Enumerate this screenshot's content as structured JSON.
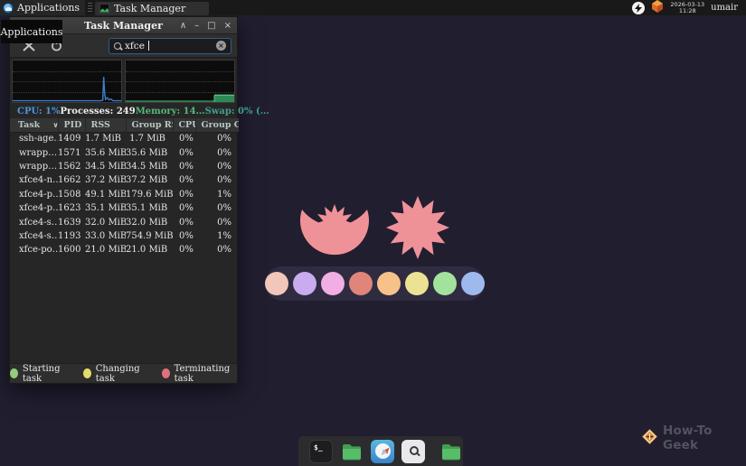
{
  "top_bar": {
    "applications_label": "Applications",
    "task_button_label": "Task Manager",
    "clock_date": "2026-03-13",
    "clock_time": "11:28",
    "username": "umair"
  },
  "tooltip": {
    "label": "Applications"
  },
  "icons": {
    "shade": "∧",
    "minimize": "–",
    "maximize": "□",
    "close": "×",
    "sort_caret": "∨",
    "clear": "×"
  },
  "window": {
    "title": "Task Manager",
    "search": {
      "value": "xfce",
      "placeholder": ""
    },
    "stats": [
      {
        "label": "CPU: 1%",
        "color": "#4f96d8"
      },
      {
        "label": "Processes: 249",
        "color": "#ededed"
      },
      {
        "label": "Memory: 14…",
        "color": "#55b877"
      },
      {
        "label": "Swap: 0% (…",
        "color": "#3fa08e"
      }
    ],
    "graphs": {
      "cpu_current_percent": 1,
      "memory_bar_fraction": 0.16,
      "memory_bar_start_fraction": 0.82,
      "cpu_color": "#3f7ec9",
      "memory_color": "#2e8a55"
    },
    "table": {
      "columns": [
        "Task",
        "PID",
        "RSS",
        "Group RSS",
        "CPU",
        "Group CPU"
      ],
      "rows": [
        [
          "ssh-age…",
          "1409",
          "1.7 MiB",
          "1.7 MiB",
          "0%",
          "0%"
        ],
        [
          "wrapp…",
          "1571",
          "35.6 MiB",
          "35.6 MiB",
          "0%",
          "0%"
        ],
        [
          "wrapp…",
          "1562",
          "34.5 MiB",
          "34.5 MiB",
          "0%",
          "0%"
        ],
        [
          "xfce4-n…",
          "1662",
          "37.2 MiB",
          "37.2 MiB",
          "0%",
          "0%"
        ],
        [
          "xfce4-p…",
          "1508",
          "49.1 MiB",
          "179.6 MiB",
          "0%",
          "1%"
        ],
        [
          "xfce4-p…",
          "1623",
          "35.1 MiB",
          "35.1 MiB",
          "0%",
          "0%"
        ],
        [
          "xfce4-s…",
          "1639",
          "32.0 MiB",
          "32.0 MiB",
          "0%",
          "0%"
        ],
        [
          "xfce4-s…",
          "1193",
          "33.0 MiB",
          "754.9 MiB",
          "0%",
          "1%"
        ],
        [
          "xfce-po…",
          "1600",
          "21.0 MiB",
          "21.0 MiB",
          "0%",
          "0%"
        ]
      ]
    },
    "legend": [
      {
        "label": "Starting task",
        "color": "#94ca7e"
      },
      {
        "label": "Changing task",
        "color": "#e7da6b"
      },
      {
        "label": "Terminating task",
        "color": "#e0707c"
      }
    ]
  },
  "desktop": {
    "shape_color": "#ef9298",
    "palette": [
      "#f2c6b8",
      "#c9abf0",
      "#f0aee2",
      "#e0857a",
      "#f6c289",
      "#ebe293",
      "#a3e29c",
      "#9db9ee"
    ]
  },
  "dock": {
    "terminal_glyph": "$_"
  },
  "watermark": {
    "label": "How-To Geek"
  }
}
